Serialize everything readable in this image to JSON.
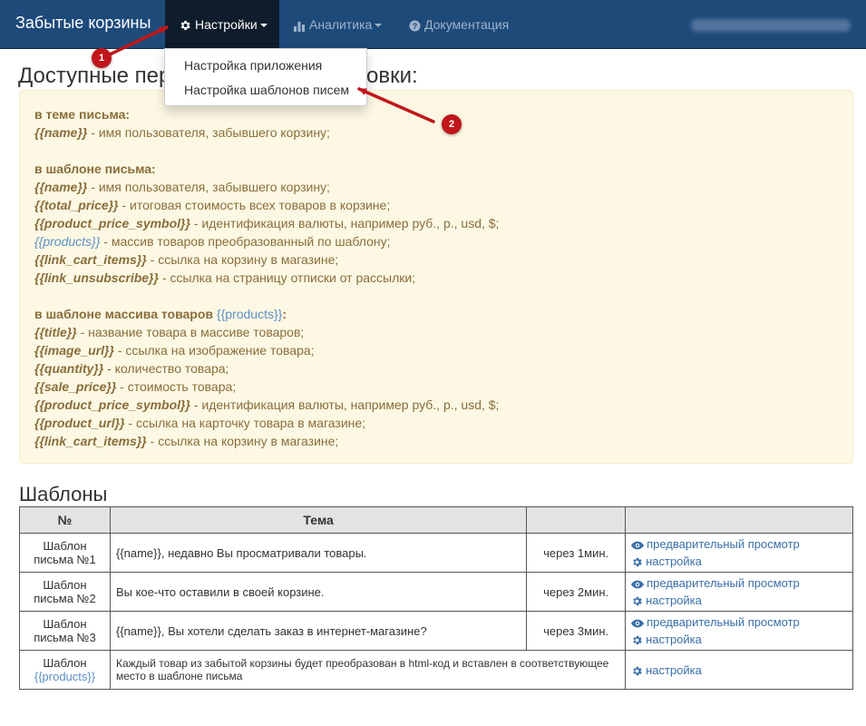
{
  "navbar": {
    "brand": "Забытые корзины",
    "items": [
      {
        "label": "Настройки",
        "icon": "gear-icon"
      },
      {
        "label": "Аналитика",
        "icon": "bar-chart-icon"
      },
      {
        "label": "Документация",
        "icon": "question-circle-icon"
      }
    ],
    "user": "www.zabytiekorziny.rf"
  },
  "dropdown": {
    "items": [
      "Настройка приложения",
      "Настройка шаблонов писем"
    ]
  },
  "annotations": [
    "1",
    "2"
  ],
  "heading": "Доступные переменные для установки:",
  "vars": {
    "subject_title": "в теме письма:",
    "subject_name": "{{name}}",
    "subject_name_desc": " - имя пользователя, забывшего корзину;",
    "body_title": "в шаблоне письма:",
    "body": [
      {
        "var": "{{name}}",
        "desc": " - имя пользователя, забывшего корзину;"
      },
      {
        "var": "{{total_price}}",
        "desc": " - итоговая стоимость всех товаров в корзине;"
      },
      {
        "var": "{{product_price_symbol}}",
        "desc": " - идентификация валюты, например руб., р., usd, $;"
      },
      {
        "var": "{{products}}",
        "desc": " - массив товаров преобразованный по шаблону;"
      },
      {
        "var": "{{link_cart_items}}",
        "desc": " - ссылка на корзину в магазине;"
      },
      {
        "var": "{{link_unsubscribe}}",
        "desc": " - ссылка на страницу отписки от рассылки;"
      }
    ],
    "products_title": "в шаблоне массива товаров ",
    "products_title_var": "{{products}}",
    "products_title_end": ":",
    "products": [
      {
        "var": "{{title}}",
        "desc": " - название товара в массиве товаров;"
      },
      {
        "var": "{{image_url}}",
        "desc": " - ссылка на изображение товара;"
      },
      {
        "var": "{{quantity}}",
        "desc": " - количество товара;"
      },
      {
        "var": "{{sale_price}}",
        "desc": " - стоимость товара;"
      },
      {
        "var": "{{product_price_symbol}}",
        "desc": " - идентификация валюты, например руб., р., usd, $;"
      },
      {
        "var": "{{product_url}}",
        "desc": " - ссылка на карточку товара в магазине;"
      },
      {
        "var": "{{link_cart_items}}",
        "desc": " - ссылка на корзину в магазине;"
      }
    ]
  },
  "templates": {
    "heading": "Шаблоны",
    "columns": [
      "№",
      "Тема",
      "",
      ""
    ],
    "rows": [
      {
        "name_1": "Шаблон",
        "name_2": "письма №1",
        "subject": "{{name}}, недавно Вы просматривали товары.",
        "delay": "через 1мин."
      },
      {
        "name_1": "Шаблон",
        "name_2": "письма №2",
        "subject": "Вы кое-что оставили в своей корзине.",
        "delay": "через 2мин."
      },
      {
        "name_1": "Шаблон",
        "name_2": "письма №3",
        "subject": "{{name}}, Вы хотели сделать заказ в интернет-магазине?",
        "delay": "через 3мин."
      }
    ],
    "last_row": {
      "name_1": "Шаблон",
      "name_2": "{{products}}",
      "subject_1": "Каждый товар из забытой корзины будет преобразован в html-код и вставлен в соответствующее",
      "subject_2": "место в шаблоне письма"
    },
    "preview_label": "предварительный просмотр",
    "settings_label": "настройка"
  }
}
